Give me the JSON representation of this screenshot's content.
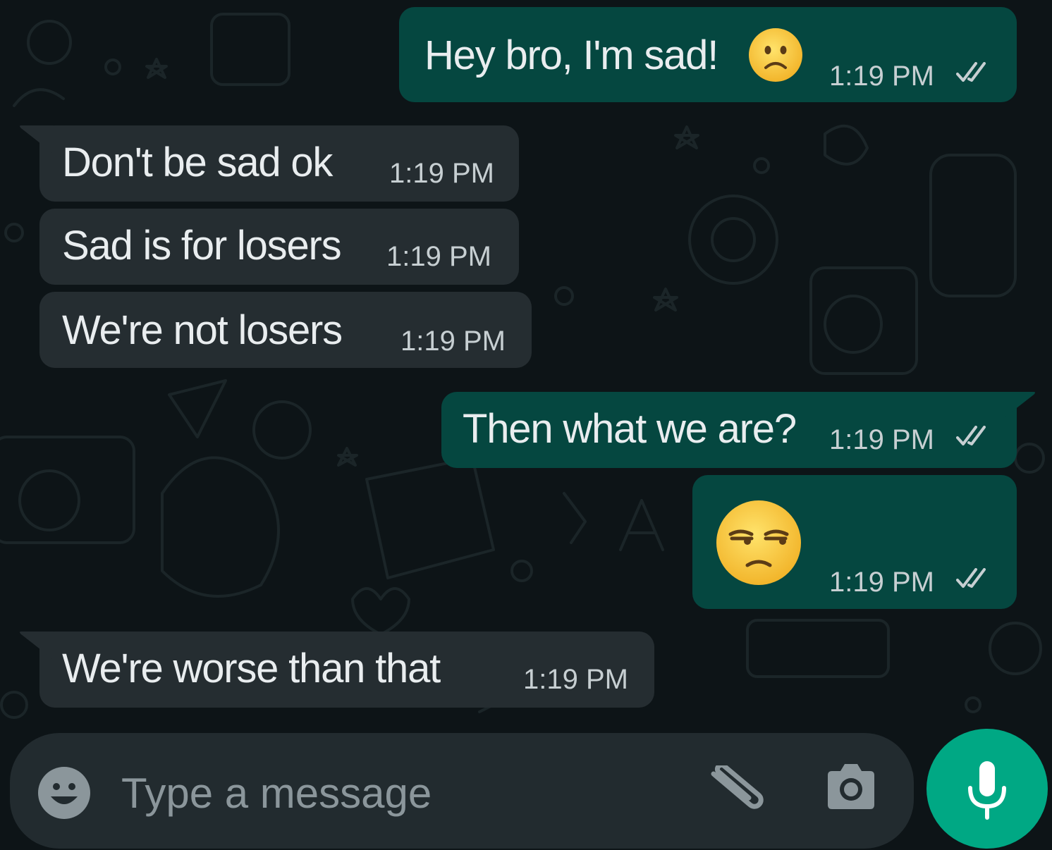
{
  "colors": {
    "background": "#0d1417",
    "incoming_bubble": "#252d31",
    "outgoing_bubble": "#054740",
    "text": "#e9edef",
    "time_text": "#c7cfd2",
    "read_ticks": "#c7cfd2",
    "composer": "#222b2f",
    "placeholder": "#8b969b",
    "mic_button": "#00a884"
  },
  "messages": [
    {
      "direction": "outgoing",
      "text": "Hey bro, I'm sad!",
      "emoji": "slightly-frowning-face",
      "time": "1:19 PM",
      "status": "read"
    },
    {
      "direction": "incoming",
      "text": "Don't be sad ok",
      "time": "1:19 PM"
    },
    {
      "direction": "incoming",
      "text": "Sad is for losers",
      "time": "1:19 PM"
    },
    {
      "direction": "incoming",
      "text": "We're not losers",
      "time": "1:19 PM"
    },
    {
      "direction": "outgoing",
      "text": "Then what we are?",
      "time": "1:19 PM",
      "status": "read"
    },
    {
      "direction": "outgoing",
      "emoji": "unamused-face",
      "time": "1:19 PM",
      "status": "read"
    },
    {
      "direction": "incoming",
      "text": "We're worse than that",
      "time": "1:19 PM"
    }
  ],
  "composer": {
    "placeholder": "Type a message",
    "value": "",
    "icons": {
      "emoji": "smiley-icon",
      "attach": "paperclip-icon",
      "camera": "camera-icon",
      "mic": "microphone-icon"
    }
  }
}
